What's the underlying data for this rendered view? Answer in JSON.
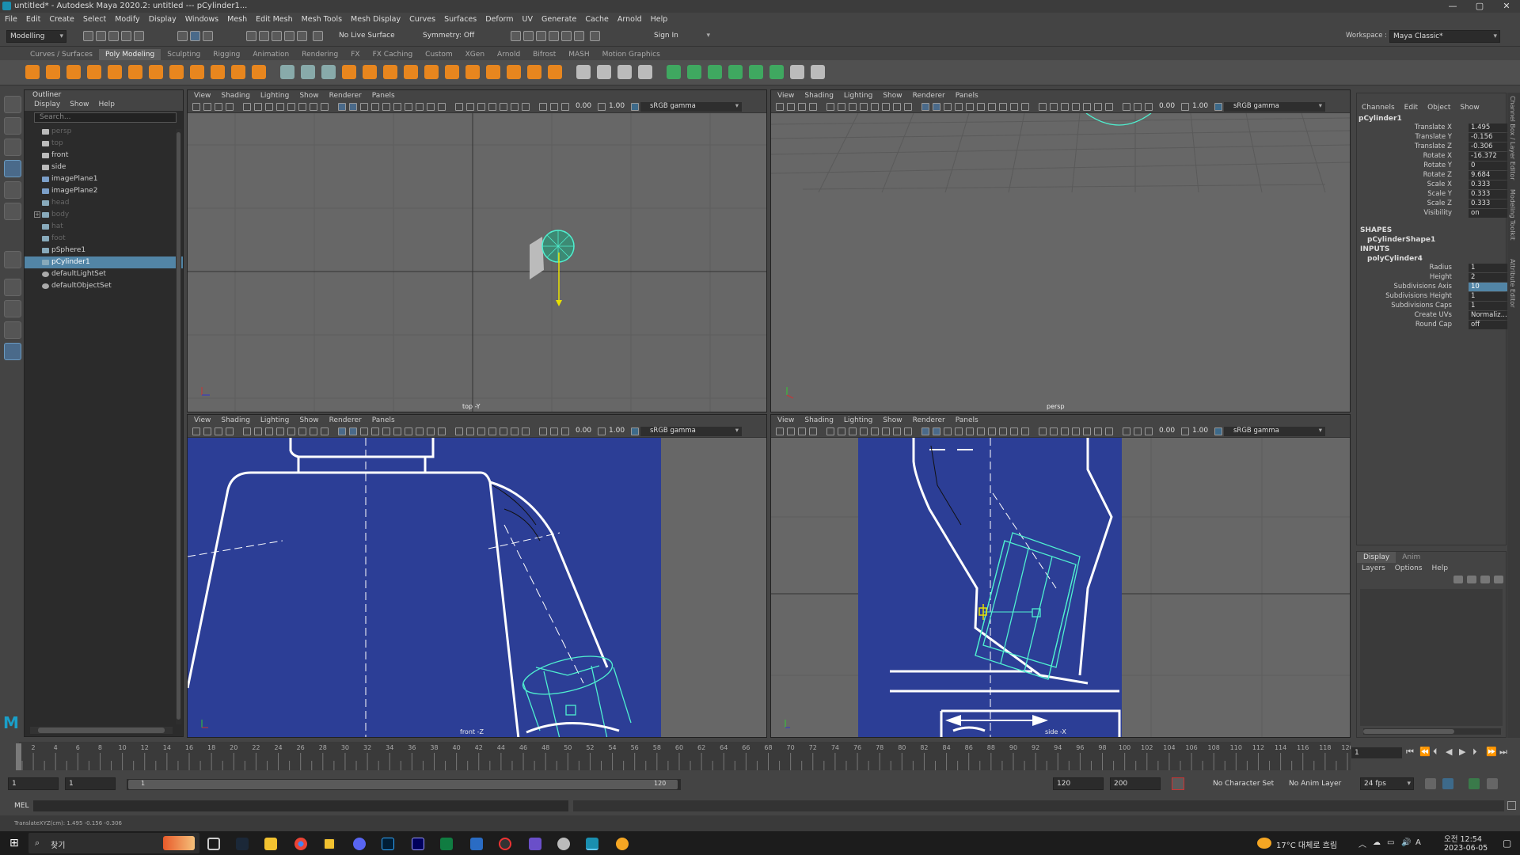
{
  "window": {
    "title": "untitled* - Autodesk Maya 2020.2: untitled   ---   pCylinder1...",
    "min": "—",
    "max": "▢",
    "close": "✕"
  },
  "menubar": [
    "File",
    "Edit",
    "Create",
    "Select",
    "Modify",
    "Display",
    "Windows",
    "Mesh",
    "Edit Mesh",
    "Mesh Tools",
    "Mesh Display",
    "Curves",
    "Surfaces",
    "Deform",
    "UV",
    "Generate",
    "Cache",
    "Arnold",
    "Help"
  ],
  "statusline": {
    "mode": "Modelling",
    "live_surface": "No Live Surface",
    "symmetry": "Symmetry: Off",
    "sign_in": "Sign In",
    "workspace_label": "Workspace :",
    "workspace": "Maya Classic*"
  },
  "shelf_tabs": [
    "Curves / Surfaces",
    "Poly Modeling",
    "Sculpting",
    "Rigging",
    "Animation",
    "Rendering",
    "FX",
    "FX Caching",
    "Custom",
    "XGen",
    "Arnold",
    "Bifrost",
    "MASH",
    "Motion Graphics"
  ],
  "outliner": {
    "title": "Outliner",
    "menu": [
      "Display",
      "Show",
      "Help"
    ],
    "search_placeholder": "Search...",
    "items": [
      {
        "label": "persp",
        "icon": "camera",
        "dim": true
      },
      {
        "label": "top",
        "icon": "camera",
        "dim": true
      },
      {
        "label": "front",
        "icon": "camera",
        "dim": false
      },
      {
        "label": "side",
        "icon": "camera",
        "dim": false
      },
      {
        "label": "imagePlane1",
        "icon": "imageplane",
        "dim": false
      },
      {
        "label": "imagePlane2",
        "icon": "imageplane",
        "dim": false
      },
      {
        "label": "head",
        "icon": "mesh",
        "dim": true
      },
      {
        "label": "body",
        "icon": "group",
        "dim": true
      },
      {
        "label": "hat",
        "icon": "mesh",
        "dim": true
      },
      {
        "label": "foot",
        "icon": "mesh",
        "dim": true
      },
      {
        "label": "pSphere1",
        "icon": "mesh",
        "dim": false
      },
      {
        "label": "pCylinder1",
        "icon": "mesh",
        "dim": false,
        "selected": true
      },
      {
        "label": "defaultLightSet",
        "icon": "set",
        "dim": false
      },
      {
        "label": "defaultObjectSet",
        "icon": "set",
        "dim": false
      }
    ]
  },
  "viewports": {
    "menu": [
      "View",
      "Shading",
      "Lighting",
      "Show",
      "Renderer",
      "Panels"
    ],
    "exposure": "0.00",
    "gamma": "1.00",
    "color_space": "sRGB gamma",
    "top_left_label": "top -Y",
    "top_right_label": "persp",
    "bottom_left_label": "front -Z",
    "bottom_right_label": "side -X"
  },
  "channelbox": {
    "menu": [
      "Channels",
      "Edit",
      "Object",
      "Show"
    ],
    "object": "pCylinder1",
    "channels": [
      {
        "label": "Translate X",
        "value": "1.495"
      },
      {
        "label": "Translate Y",
        "value": "-0.156"
      },
      {
        "label": "Translate Z",
        "value": "-0.306"
      },
      {
        "label": "Rotate X",
        "value": "-16.372"
      },
      {
        "label": "Rotate Y",
        "value": "0"
      },
      {
        "label": "Rotate Z",
        "value": "9.684"
      },
      {
        "label": "Scale X",
        "value": "0.333"
      },
      {
        "label": "Scale Y",
        "value": "0.333"
      },
      {
        "label": "Scale Z",
        "value": "0.333"
      },
      {
        "label": "Visibility",
        "value": "on"
      }
    ],
    "shapes_header": "SHAPES",
    "shape": "pCylinderShape1",
    "inputs_header": "INPUTS",
    "input": "polyCylinder4",
    "inputs": [
      {
        "label": "Radius",
        "value": "1"
      },
      {
        "label": "Height",
        "value": "2"
      },
      {
        "label": "Subdivisions Axis",
        "value": "10",
        "highlight": true
      },
      {
        "label": "Subdivisions Height",
        "value": "1"
      },
      {
        "label": "Subdivisions Caps",
        "value": "1"
      },
      {
        "label": "Create UVs",
        "value": "Normaliz..."
      },
      {
        "label": "Round Cap",
        "value": "off"
      }
    ]
  },
  "layer_editor": {
    "tabs": [
      "Display",
      "Anim"
    ],
    "menu": [
      "Layers",
      "Options",
      "Help"
    ]
  },
  "side_tabs": [
    "Channel Box / Layer Editor",
    "Modeling Toolkit",
    "Attribute Editor"
  ],
  "timeline": {
    "start": 1,
    "end": 120,
    "step": 2,
    "current_frame": "1"
  },
  "range": {
    "start": "1",
    "start2": "1",
    "slider_start": "1",
    "slider_end": "120",
    "end": "120",
    "end2": "200",
    "character_set": "No Character Set",
    "anim_layer": "No Anim Layer",
    "fps": "24 fps"
  },
  "cmdline": {
    "label": "MEL"
  },
  "helpline": {
    "text": "TranslateXYZ(cm):     1.495          -0.156          -0.306"
  },
  "taskbar": {
    "search": "찾기",
    "weather": "17°C 대체로 흐림",
    "time_period": "오전 12:54",
    "date": "2023-06-05"
  },
  "colors": {
    "selection": "#5285a6",
    "viewport_bg": "#676767",
    "image_plane": "#2c3e96",
    "wire": "#4ff0d0"
  }
}
